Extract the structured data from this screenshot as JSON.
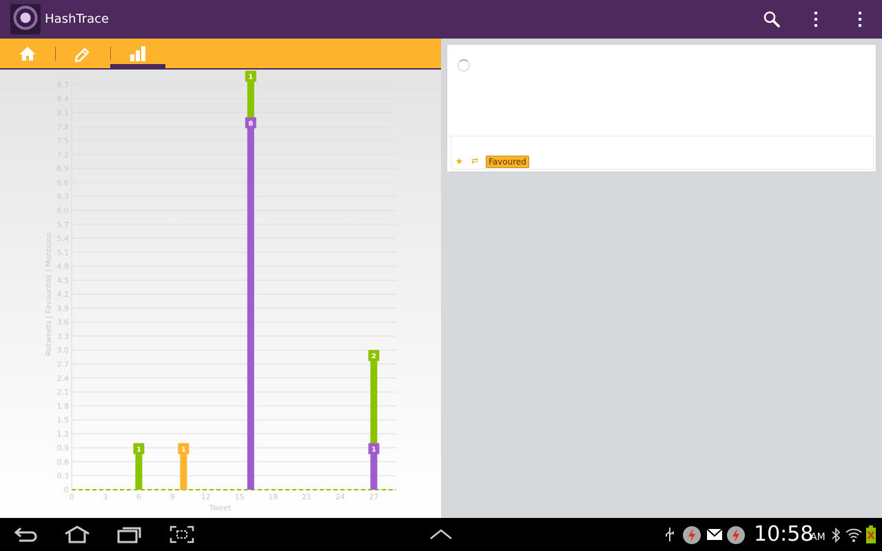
{
  "app": {
    "title": "HashTrace",
    "icon": "eye-logo-icon"
  },
  "actionbar": {
    "buttons": [
      "search-icon",
      "overflow-menu-icon",
      "overflow-menu-icon"
    ]
  },
  "tabs": [
    {
      "icon": "home-icon",
      "selected": false
    },
    {
      "icon": "pencil-icon",
      "selected": false
    },
    {
      "icon": "bar-chart-icon",
      "selected": true
    }
  ],
  "colors": {
    "accent": "#fdb32b",
    "brand": "#4d2a5d",
    "retweets": "#a05ccc",
    "favourites": "#fdb32b",
    "mentions": "#8cc300"
  },
  "chart_data": {
    "type": "bar",
    "stacked": true,
    "xlabel": "Tweet",
    "ylabel": "Retweets | Favourites | Mentions",
    "ylim": [
      0,
      8.7
    ],
    "xlim": [
      0,
      29
    ],
    "yticks": [
      "0",
      "0.3",
      "0.6",
      "0.9",
      "1.2",
      "1.5",
      "1.8",
      "2.1",
      "2.4",
      "2.7",
      "3.0",
      "3.3",
      "3.6",
      "3.9",
      "4.2",
      "4.5",
      "4.8",
      "5.1",
      "5.4",
      "5.7",
      "6.0",
      "6.3",
      "6.6",
      "6.9",
      "7.2",
      "7.5",
      "7.8",
      "8.1",
      "8.4",
      "8.7"
    ],
    "xticks": [
      "0",
      "3",
      "6",
      "9",
      "12",
      "15",
      "18",
      "21",
      "24",
      "27"
    ],
    "grid": true,
    "bars": [
      {
        "x": 6,
        "segments": [
          {
            "series": "mentions",
            "value": 1,
            "label": "1"
          }
        ]
      },
      {
        "x": 10,
        "segments": [
          {
            "series": "favourites",
            "value": 1,
            "label": "1"
          }
        ]
      },
      {
        "x": 16,
        "segments": [
          {
            "series": "retweets",
            "value": 8,
            "label": "8"
          },
          {
            "series": "mentions",
            "value": 1,
            "label": "1"
          }
        ]
      },
      {
        "x": 27,
        "segments": [
          {
            "series": "retweets",
            "value": 1,
            "label": "1"
          },
          {
            "series": "mentions",
            "value": 2,
            "label": "2"
          }
        ]
      }
    ]
  },
  "tweet_card": {
    "badge": "Favoured",
    "star_icon": "star-icon",
    "retweet_icon": "retweet-icon"
  },
  "navbar": {
    "buttons": [
      "back-icon",
      "home-icon",
      "recent-apps-icon",
      "screenshot-icon",
      "chevron-up-icon"
    ]
  },
  "status_bar": {
    "time": "10:58",
    "ampm": "AM",
    "icons": [
      "usb-icon",
      "flash-icon",
      "gmail-icon",
      "flash-icon",
      "bluetooth-icon",
      "wifi-icon",
      "battery-icon"
    ]
  }
}
